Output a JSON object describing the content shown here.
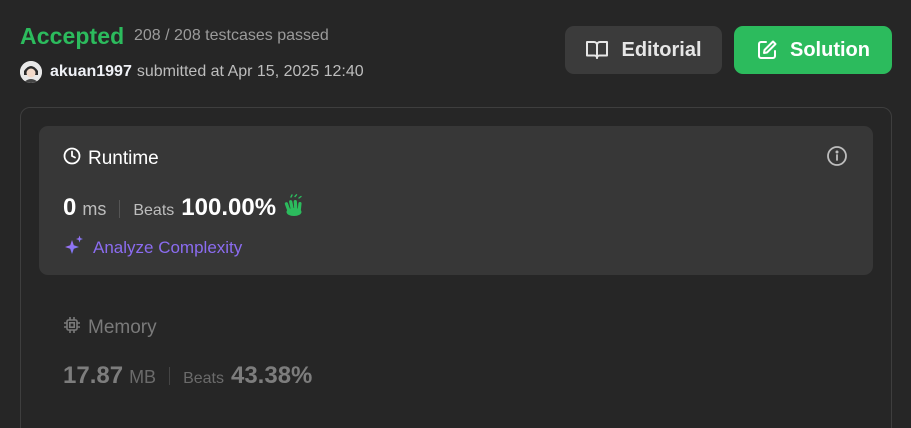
{
  "result": {
    "status": "Accepted",
    "testcases": "208 / 208 testcases passed",
    "username": "akuan1997",
    "submitted_text": "submitted at Apr 15, 2025 12:40"
  },
  "buttons": {
    "editorial": "Editorial",
    "solution": "Solution"
  },
  "runtime": {
    "title": "Runtime",
    "value": "0",
    "unit": "ms",
    "beats_label": "Beats",
    "beats_value": "100.00%",
    "analyze_label": "Analyze Complexity"
  },
  "memory": {
    "title": "Memory",
    "value": "17.87",
    "unit": "MB",
    "beats_label": "Beats",
    "beats_value": "43.38%"
  },
  "icons": {
    "editorial": "book-open-icon",
    "solution": "edit-square-icon",
    "runtime": "clock-icon",
    "info": "info-icon",
    "beats": "clap-icon",
    "analyze": "sparkle-icon",
    "memory": "chip-icon"
  },
  "colors": {
    "accepted": "#2cbb5d",
    "analyze": "#8b6cf0",
    "background": "#262626",
    "card": "#373737"
  }
}
